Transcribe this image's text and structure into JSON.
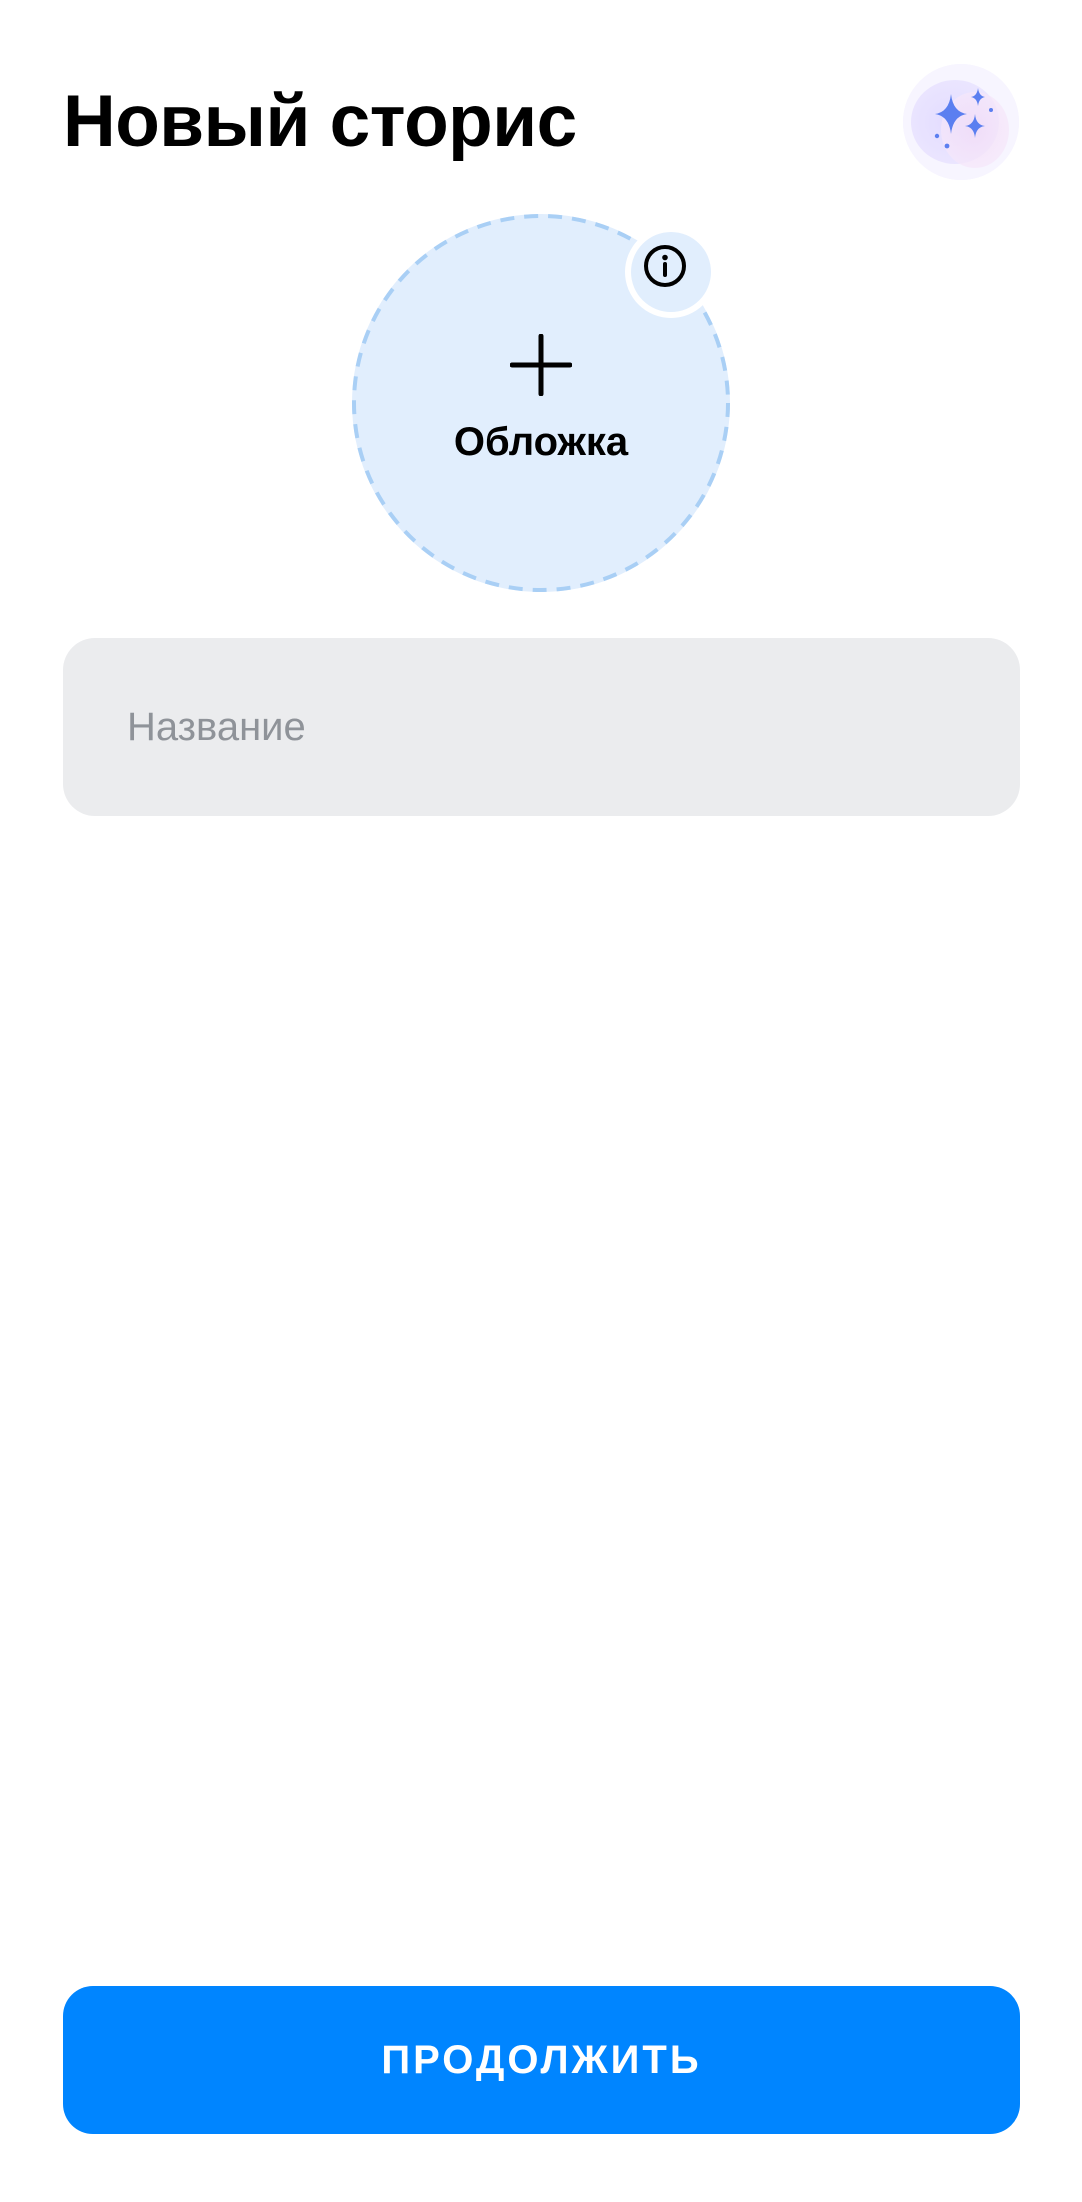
{
  "header": {
    "title": "Новый сторис",
    "ai_button_icon": "sparkles-icon"
  },
  "cover": {
    "label": "Обложка",
    "plus_icon": "plus-icon",
    "info_icon": "info-icon"
  },
  "name_field": {
    "placeholder": "Название",
    "value": ""
  },
  "footer": {
    "continue_label": "ПРОДОЛЖИТЬ"
  },
  "colors": {
    "accent": "#0085ff",
    "cover_bg": "#e1eefd",
    "cover_border": "#a9cff5",
    "field_bg": "#ebecee",
    "placeholder": "#8f9399",
    "sparkle": "#5b7ff0"
  }
}
